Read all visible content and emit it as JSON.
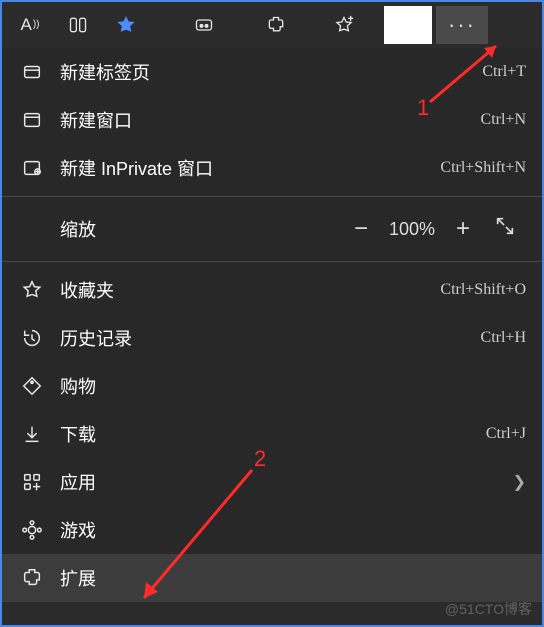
{
  "toolbar": {
    "readaloud": "A",
    "more_glyph": "···"
  },
  "menu": {
    "new_tab": {
      "label": "新建标签页",
      "shortcut": "Ctrl+T"
    },
    "new_window": {
      "label": "新建窗口",
      "shortcut": "Ctrl+N"
    },
    "new_inprivate": {
      "label": "新建 InPrivate 窗口",
      "shortcut": "Ctrl+Shift+N"
    },
    "zoom": {
      "label": "缩放",
      "level": "100%"
    },
    "favorites": {
      "label": "收藏夹",
      "shortcut": "Ctrl+Shift+O"
    },
    "history": {
      "label": "历史记录",
      "shortcut": "Ctrl+H"
    },
    "shopping": {
      "label": "购物"
    },
    "downloads": {
      "label": "下载",
      "shortcut": "Ctrl+J"
    },
    "apps": {
      "label": "应用"
    },
    "games": {
      "label": "游戏"
    },
    "extensions": {
      "label": "扩展"
    }
  },
  "annotations": {
    "one": "1",
    "two": "2"
  },
  "watermark": "@51CTO博客"
}
